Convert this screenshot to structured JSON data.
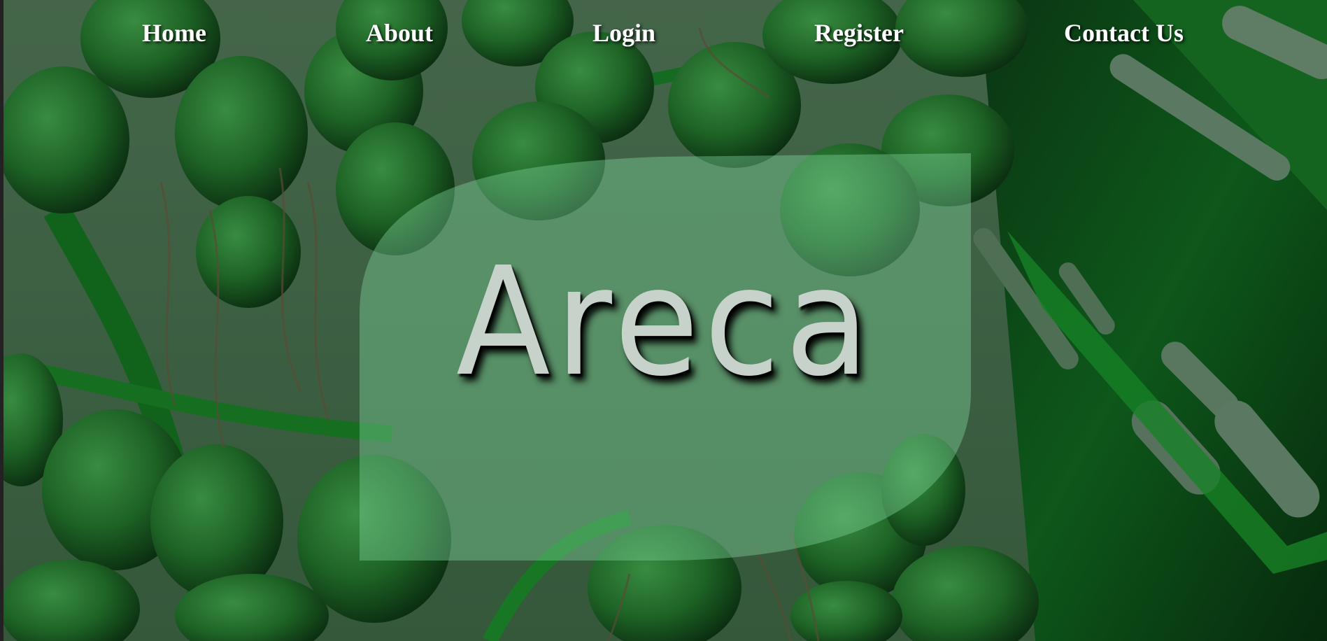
{
  "nav": {
    "items": [
      {
        "label": "Home"
      },
      {
        "label": "About"
      },
      {
        "label": "Login"
      },
      {
        "label": "Register"
      },
      {
        "label": "Contact Us"
      }
    ]
  },
  "hero": {
    "title": "Areca",
    "background_icon": "areca-palm-fruit-photo",
    "overlay_color": "#5fbf7f"
  },
  "colors": {
    "nav_text": "#ffffff",
    "title_text": "#c7d2cb",
    "leaf_green": "#1fa833",
    "fruit_green": "#2f8f3a"
  }
}
